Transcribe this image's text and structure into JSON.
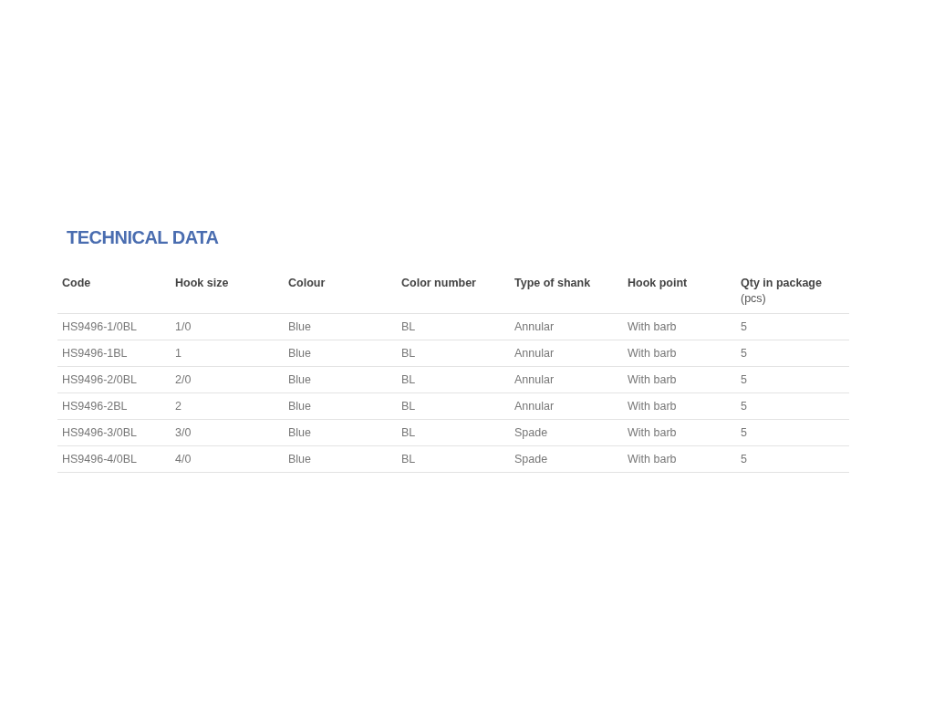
{
  "section": {
    "title": "TECHNICAL DATA"
  },
  "table": {
    "columns": [
      {
        "label": "Code"
      },
      {
        "label": "Hook size"
      },
      {
        "label": "Colour"
      },
      {
        "label": "Color number"
      },
      {
        "label": "Type of shank"
      },
      {
        "label": "Hook point"
      },
      {
        "label": "Qty in package",
        "unit": "(pcs)"
      }
    ],
    "rows": [
      [
        "HS9496-1/0BL",
        "1/0",
        "Blue",
        "BL",
        "Annular",
        "With barb",
        "5"
      ],
      [
        "HS9496-1BL",
        "1",
        "Blue",
        "BL",
        "Annular",
        "With barb",
        "5"
      ],
      [
        "HS9496-2/0BL",
        "2/0",
        "Blue",
        "BL",
        "Annular",
        "With barb",
        "5"
      ],
      [
        "HS9496-2BL",
        "2",
        "Blue",
        "BL",
        "Annular",
        "With barb",
        "5"
      ],
      [
        "HS9496-3/0BL",
        "3/0",
        "Blue",
        "BL",
        "Spade",
        "With barb",
        "5"
      ],
      [
        "HS9496-4/0BL",
        "4/0",
        "Blue",
        "BL",
        "Spade",
        "With barb",
        "5"
      ]
    ]
  }
}
